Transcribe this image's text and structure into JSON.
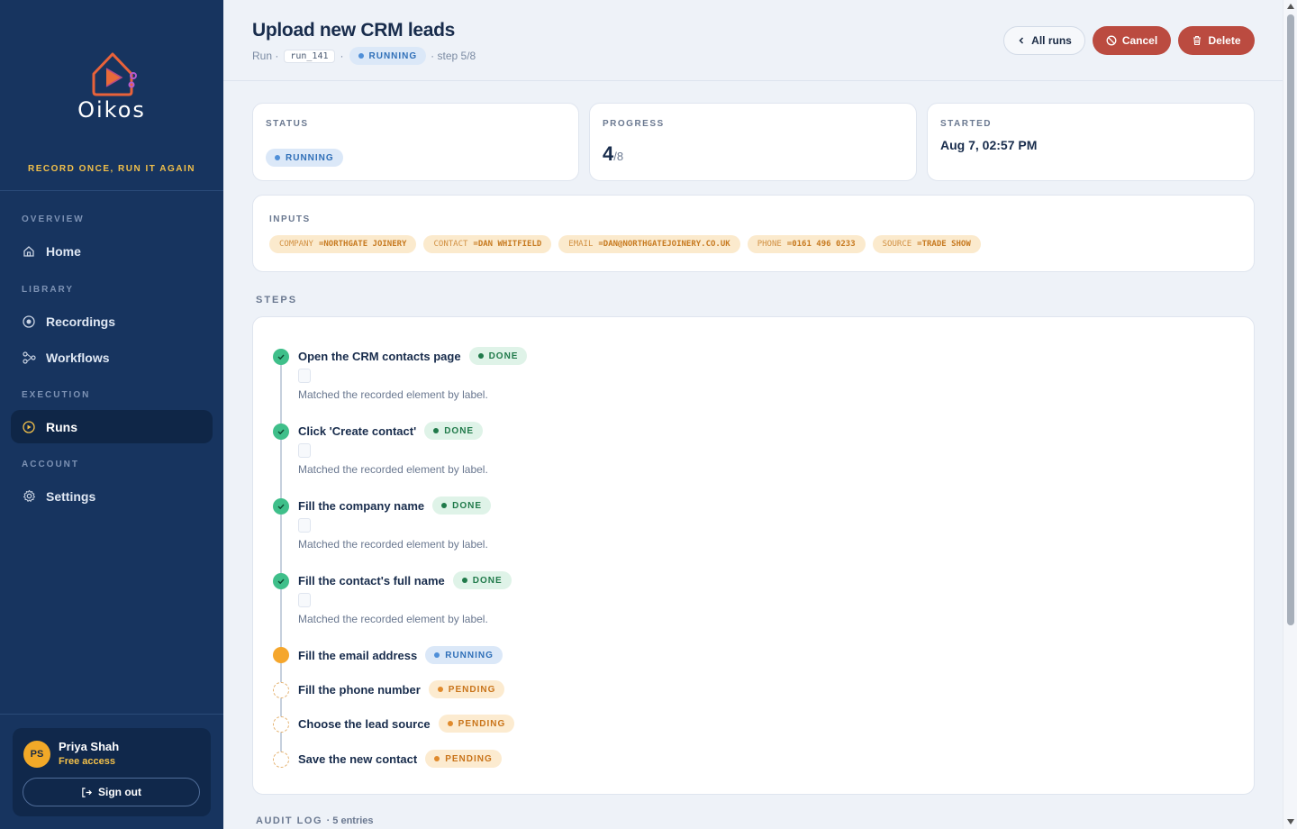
{
  "brand": {
    "name": "Oikos",
    "tagline": "RECORD ONCE, RUN IT AGAIN"
  },
  "nav": {
    "sections": {
      "overview": "OVERVIEW",
      "library": "LIBRARY",
      "execution": "EXECUTION",
      "account": "ACCOUNT"
    },
    "items": {
      "home": "Home",
      "recordings": "Recordings",
      "workflows": "Workflows",
      "runs": "Runs",
      "settings": "Settings"
    },
    "active": "runs"
  },
  "user": {
    "initials": "PS",
    "name": "Priya Shah",
    "plan": "Free access",
    "signout_label": "Sign out"
  },
  "header": {
    "title": "Upload new CRM leads",
    "run_prefix": "Run ·",
    "run_id": "run_141",
    "sep": "·",
    "status": "RUNNING",
    "step_text": "· step 5/8",
    "all_runs_label": "All runs",
    "cancel_label": "Cancel",
    "delete_label": "Delete"
  },
  "stats": {
    "status_label": "STATUS",
    "status_value": "RUNNING",
    "progress_label": "PROGRESS",
    "progress_done": "4",
    "progress_total": "/8",
    "started_label": "STARTED",
    "started_value": "Aug 7, 02:57 PM"
  },
  "inputs": {
    "label": "INPUTS",
    "chips": [
      {
        "key": "COMPANY",
        "value": "=NORTHGATE JOINERY"
      },
      {
        "key": "CONTACT",
        "value": "=DAN WHITFIELD"
      },
      {
        "key": "EMAIL",
        "value": "=DAN@NORTHGATEJOINERY.CO.UK"
      },
      {
        "key": "PHONE",
        "value": "=0161 496 0233"
      },
      {
        "key": "SOURCE",
        "value": "=TRADE SHOW"
      }
    ]
  },
  "steps": {
    "label": "STEPS",
    "items": [
      {
        "title": "Open the CRM contacts page",
        "status": "DONE",
        "note": "Matched the recorded element by label."
      },
      {
        "title": "Click 'Create contact'",
        "status": "DONE",
        "note": "Matched the recorded element by label."
      },
      {
        "title": "Fill the company name",
        "status": "DONE",
        "note": "Matched the recorded element by label."
      },
      {
        "title": "Fill the contact's full name",
        "status": "DONE",
        "note": "Matched the recorded element by label."
      },
      {
        "title": "Fill the email address",
        "status": "RUNNING"
      },
      {
        "title": "Fill the phone number",
        "status": "PENDING"
      },
      {
        "title": "Choose the lead source",
        "status": "PENDING"
      },
      {
        "title": "Save the new contact",
        "status": "PENDING"
      }
    ]
  },
  "audit": {
    "label": "AUDIT LOG",
    "count": "· 5 entries"
  },
  "colors": {
    "sidebar": "#17345f",
    "accent_yellow": "#f2c04a",
    "danger": "#bb4b40",
    "done": "#3fbf8a",
    "running": "#f5a62c"
  }
}
